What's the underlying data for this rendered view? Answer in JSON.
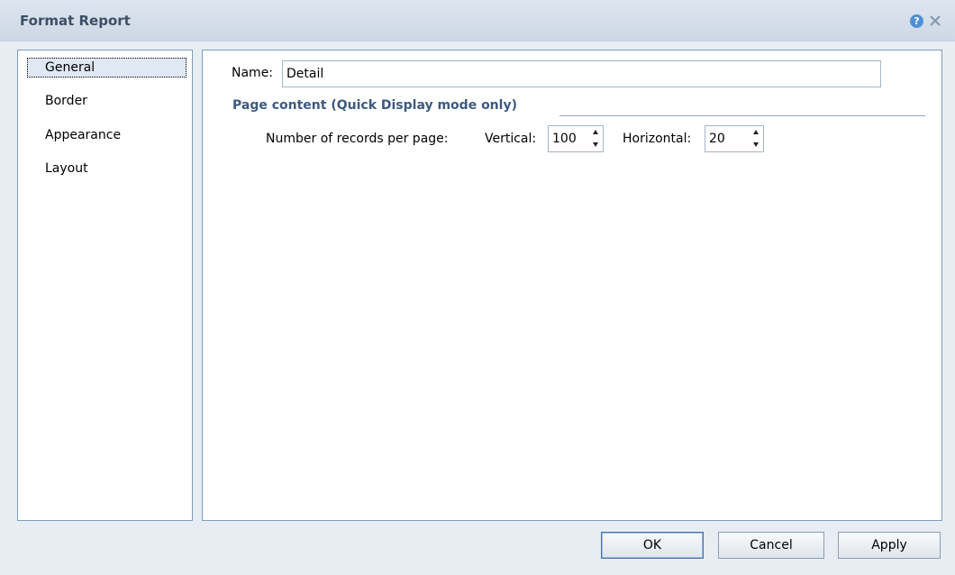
{
  "window": {
    "title": "Format Report",
    "help_glyph": "?"
  },
  "sidebar": {
    "items": [
      {
        "label": "General",
        "selected": true
      },
      {
        "label": "Border",
        "selected": false
      },
      {
        "label": "Appearance",
        "selected": false
      },
      {
        "label": "Layout",
        "selected": false
      }
    ]
  },
  "general": {
    "name_label": "Name:",
    "name_value": "Detail",
    "section_title": "Page content (Quick Display mode only)",
    "records_label": "Number of records per page:",
    "vertical_label": "Vertical:",
    "vertical_value": "100",
    "horizontal_label": "Horizontal:",
    "horizontal_value": "20"
  },
  "buttons": {
    "ok": "OK",
    "cancel": "Cancel",
    "apply": "Apply"
  },
  "icons": {
    "help": "help-icon",
    "close": "close-icon",
    "spin_up": "spin-up-icon",
    "spin_down": "spin-down-icon"
  },
  "colors": {
    "title_text": "#3d4f66",
    "section_title": "#3d5a80",
    "help_icon": "#4f8fd6",
    "panel_border": "#7f9db9"
  }
}
